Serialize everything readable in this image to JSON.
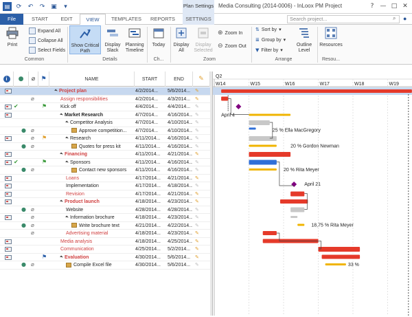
{
  "window": {
    "doc_title": "Media Consulting (2014-0006) - InLoox PM Project",
    "plan_context_label": "Plan Settings",
    "controls": [
      "?",
      "—",
      "□",
      "✕"
    ]
  },
  "tabs": [
    {
      "label": "File",
      "kind": "file"
    },
    {
      "label": "START",
      "kind": "normal"
    },
    {
      "label": "EDIT",
      "kind": "normal"
    },
    {
      "label": "VIEW",
      "kind": "active"
    },
    {
      "label": "TEMPLATES",
      "kind": "normal"
    },
    {
      "label": "REPORTS",
      "kind": "normal"
    },
    {
      "label": "SETTINGS",
      "kind": "ctx"
    }
  ],
  "search": {
    "placeholder": "Search project..."
  },
  "ribbon": {
    "print": "Print",
    "expand_all": "Expand All",
    "collapse_all": "Collapse All",
    "select_fields": "Select Fields",
    "show_critical_path": "Show Critical Path",
    "display_slack": "Display Slack",
    "planning_timeline": "Planning Timeline",
    "today": "Today",
    "display_all": "Display All",
    "display_selected": "Display Selected",
    "zoom_in": "Zoom In",
    "zoom_out": "Zoom Out",
    "group_sort": "Sort by",
    "group_group": "Group by",
    "group_filter": "Filter by",
    "outline_level": "Outline Level",
    "resources": "Resources",
    "groups": {
      "common": "Common",
      "details": "Details",
      "ch": "Ch...",
      "zoom": "Zoom",
      "arrange": "Arrange",
      "resou": "Resou..."
    }
  },
  "grid": {
    "columns": {
      "name": "NAME",
      "start": "START",
      "end": "END"
    },
    "rows": [
      {
        "name": "Project plan",
        "start": "4/2/2014...",
        "end": "5/6/2014...",
        "indent": 0,
        "style": "red-bold-summary",
        "pinned": true,
        "selected": true
      },
      {
        "name": "Assign responsibilities",
        "start": "4/2/2014...",
        "end": "4/3/2014...",
        "indent": 1,
        "style": "red",
        "pinned": true
      },
      {
        "name": "Kick off",
        "start": "4/4/2014...",
        "end": "4/4/2014...",
        "indent": 1,
        "style": "normal",
        "pinned": false
      },
      {
        "name": "Market Research",
        "start": "4/7/2014...",
        "end": "4/16/2014...",
        "indent": 1,
        "style": "bold-summary",
        "pinned": false
      },
      {
        "name": "Competitor Analysis",
        "start": "4/7/2014...",
        "end": "4/10/2014...",
        "indent": 2,
        "style": "summary",
        "pinned": false
      },
      {
        "name": "Approve competition...",
        "start": "4/7/2014...",
        "end": "4/10/2014...",
        "indent": 3,
        "style": "box",
        "pinned": false
      },
      {
        "name": "Research",
        "start": "4/11/2014...",
        "end": "4/16/2014...",
        "indent": 2,
        "style": "summary",
        "pinned": false
      },
      {
        "name": "Quotes for press kit",
        "start": "4/11/2014...",
        "end": "4/16/2014...",
        "indent": 3,
        "style": "box",
        "pinned": false
      },
      {
        "name": "Financing",
        "start": "4/11/2014...",
        "end": "4/21/2014...",
        "indent": 1,
        "style": "red-bold-summary",
        "pinned": true
      },
      {
        "name": "Sponsors",
        "start": "4/11/2014...",
        "end": "4/16/2014...",
        "indent": 2,
        "style": "summary",
        "pinned": false
      },
      {
        "name": "Contact new sponsors",
        "start": "4/11/2014...",
        "end": "4/16/2014...",
        "indent": 3,
        "style": "box",
        "pinned": false
      },
      {
        "name": "Loans",
        "start": "4/17/2014...",
        "end": "4/21/2014...",
        "indent": 2,
        "style": "red",
        "pinned": true
      },
      {
        "name": "Implementation",
        "start": "4/17/2014...",
        "end": "4/18/2014...",
        "indent": 2,
        "style": "normal",
        "pinned": false
      },
      {
        "name": "Revision",
        "start": "4/17/2014...",
        "end": "4/21/2014...",
        "indent": 2,
        "style": "red",
        "pinned": true
      },
      {
        "name": "Product launch",
        "start": "4/18/2014...",
        "end": "4/23/2014...",
        "indent": 1,
        "style": "red-bold-summary",
        "pinned": true
      },
      {
        "name": "Website",
        "start": "4/28/2014...",
        "end": "4/28/2014...",
        "indent": 2,
        "style": "normal",
        "pinned": false
      },
      {
        "name": "Information brochure",
        "start": "4/18/2014...",
        "end": "4/23/2014...",
        "indent": 2,
        "style": "summary",
        "pinned": false
      },
      {
        "name": "Write brochure text",
        "start": "4/21/2014...",
        "end": "4/22/2014...",
        "indent": 3,
        "style": "box",
        "pinned": false
      },
      {
        "name": "Advertising material",
        "start": "4/18/2014...",
        "end": "4/23/2014...",
        "indent": 2,
        "style": "red",
        "pinned": true
      },
      {
        "name": "Media analysis",
        "start": "4/18/2014...",
        "end": "4/25/2014...",
        "indent": 1,
        "style": "red",
        "pinned": true
      },
      {
        "name": "Communication",
        "start": "4/25/2014...",
        "end": "5/2/2014...",
        "indent": 1,
        "style": "red",
        "pinned": true
      },
      {
        "name": "Evaluation",
        "start": "4/30/2014...",
        "end": "5/6/2014...",
        "indent": 1,
        "style": "red-bold-summary",
        "pinned": true
      },
      {
        "name": "Compile Excel file",
        "start": "4/30/2014...",
        "end": "5/6/2014...",
        "indent": 2,
        "style": "box",
        "pinned": false
      }
    ]
  },
  "gantt": {
    "quarter": "Q2",
    "weeks": [
      "W14",
      "W15",
      "W16",
      "W17",
      "W18",
      "W19"
    ],
    "labels": {
      "kickoff": "April 4",
      "competitor": "25 % Ella MacGregory",
      "research": "20 % Gordon Newman",
      "sponsors": "20 % Rita Meyer",
      "loans": "April 21",
      "brochure": "18,75 % Rita Meyer",
      "excel": "33 %"
    }
  },
  "colors": {
    "accent": "#2b5fa8",
    "critical": "#e53a2a",
    "progress": "#f0b400",
    "baseline": "#c8c8c8",
    "milestone": "#800080",
    "summary_blue": "#2f6fd8"
  }
}
